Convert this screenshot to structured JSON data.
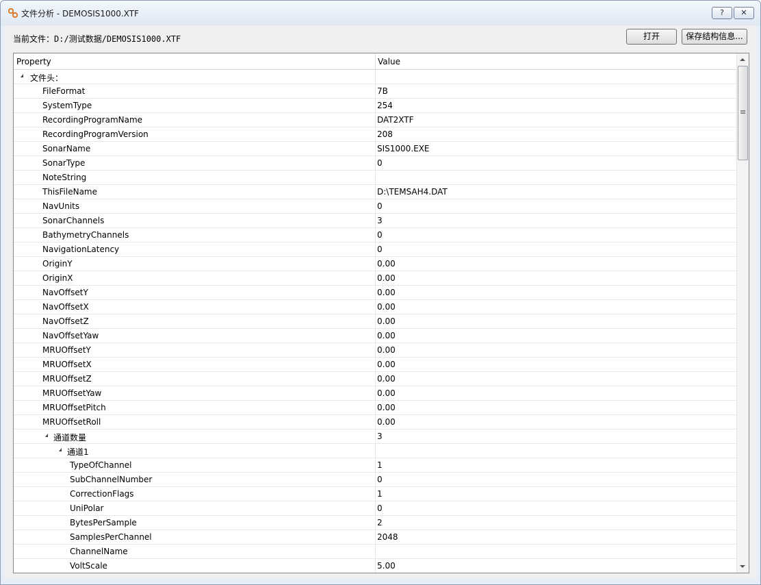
{
  "window": {
    "title": "文件分析 - DEMOSIS1000.XTF",
    "help_label": "?",
    "close_label": "✕"
  },
  "toolbar": {
    "file_label_prefix": "当前文件：",
    "file_path": "D:/测试数据/DEMOSIS1000.XTF",
    "open_label": "打开",
    "save_label": "保存结构信息..."
  },
  "grid": {
    "col_property": "Property",
    "col_value": "Value",
    "rows": [
      {
        "level": 0,
        "expander": true,
        "prop": "文件头：",
        "val": ""
      },
      {
        "level": 1,
        "prop": "FileFormat",
        "val": "7B"
      },
      {
        "level": 1,
        "prop": "SystemType",
        "val": "254"
      },
      {
        "level": 1,
        "prop": "RecordingProgramName",
        "val": "DAT2XTF"
      },
      {
        "level": 1,
        "prop": "RecordingProgramVersion",
        "val": "208"
      },
      {
        "level": 1,
        "prop": "SonarName",
        "val": "SIS1000.EXE"
      },
      {
        "level": 1,
        "prop": "SonarType",
        "val": "0"
      },
      {
        "level": 1,
        "prop": "NoteString",
        "val": ""
      },
      {
        "level": 1,
        "prop": "ThisFileName",
        "val": "D:\\TEMSAH4.DAT"
      },
      {
        "level": 1,
        "prop": "NavUnits",
        "val": "0"
      },
      {
        "level": 1,
        "prop": "SonarChannels",
        "val": "3"
      },
      {
        "level": 1,
        "prop": "BathymetryChannels",
        "val": "0"
      },
      {
        "level": 1,
        "prop": "NavigationLatency",
        "val": "0"
      },
      {
        "level": 1,
        "prop": "OriginY",
        "val": "0.00"
      },
      {
        "level": 1,
        "prop": "OriginX",
        "val": "0.00"
      },
      {
        "level": 1,
        "prop": "NavOffsetY",
        "val": "0.00"
      },
      {
        "level": 1,
        "prop": "NavOffsetX",
        "val": "0.00"
      },
      {
        "level": 1,
        "prop": "NavOffsetZ",
        "val": "0.00"
      },
      {
        "level": 1,
        "prop": "NavOffsetYaw",
        "val": "0.00"
      },
      {
        "level": 1,
        "prop": "MRUOffsetY",
        "val": "0.00"
      },
      {
        "level": 1,
        "prop": "MRUOffsetX",
        "val": "0.00"
      },
      {
        "level": 1,
        "prop": "MRUOffsetZ",
        "val": "0.00"
      },
      {
        "level": 1,
        "prop": "MRUOffsetYaw",
        "val": "0.00"
      },
      {
        "level": 1,
        "prop": "MRUOffsetPitch",
        "val": "0.00"
      },
      {
        "level": 1,
        "prop": "MRUOffsetRoll",
        "val": "0.00"
      },
      {
        "level": 1,
        "expander": true,
        "prop": "通道数量",
        "val": "3"
      },
      {
        "level": 2,
        "expander": true,
        "prop": "通道1",
        "val": ""
      },
      {
        "level": 3,
        "prop": "TypeOfChannel",
        "val": "1"
      },
      {
        "level": 3,
        "prop": "SubChannelNumber",
        "val": "0"
      },
      {
        "level": 3,
        "prop": "CorrectionFlags",
        "val": "1"
      },
      {
        "level": 3,
        "prop": "UniPolar",
        "val": "0"
      },
      {
        "level": 3,
        "prop": "BytesPerSample",
        "val": "2"
      },
      {
        "level": 3,
        "prop": "SamplesPerChannel",
        "val": "2048"
      },
      {
        "level": 3,
        "prop": "ChannelName",
        "val": ""
      },
      {
        "level": 3,
        "prop": "VoltScale",
        "val": "5.00"
      }
    ]
  }
}
